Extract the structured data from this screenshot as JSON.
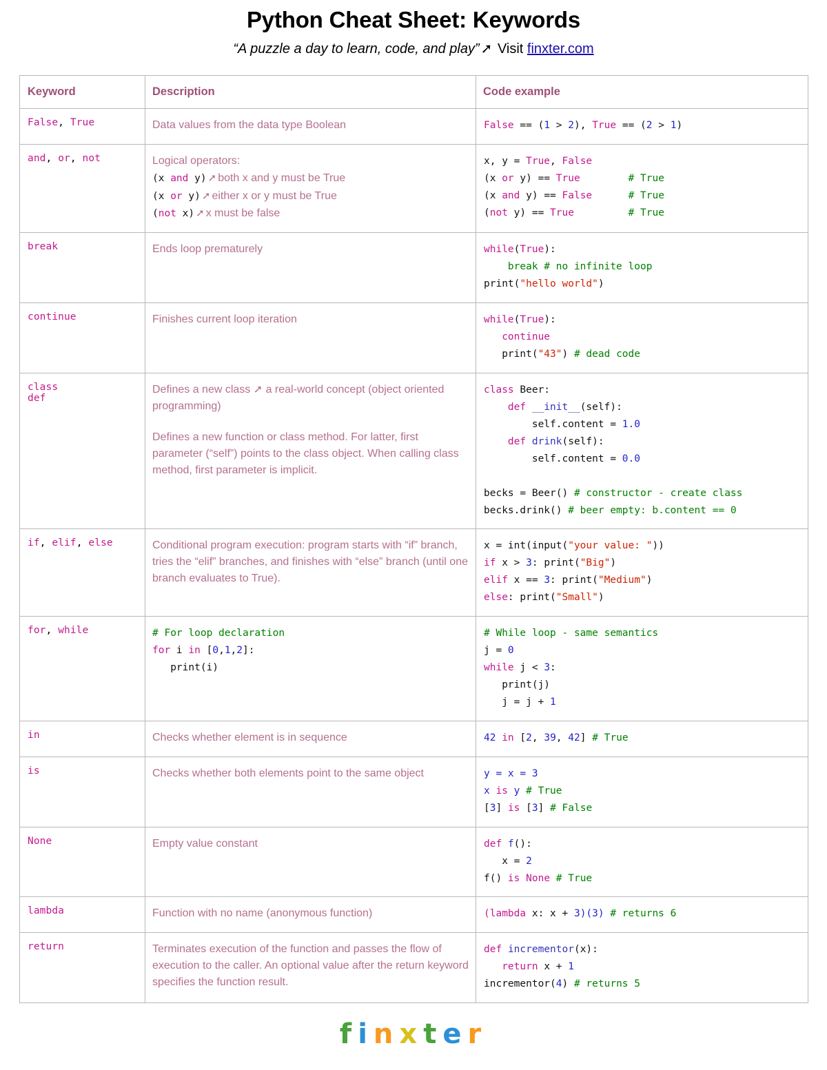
{
  "header": {
    "title": "Python Cheat Sheet: Keywords",
    "subtitle_quote": "“A puzzle a day to learn, code, and play”",
    "subtitle_arrow": "➚",
    "subtitle_visit": "Visit",
    "subtitle_link": "finxter.com"
  },
  "table": {
    "columns": [
      "Keyword",
      "Description",
      "Code example"
    ],
    "rows": [
      {
        "keyword": "False, True",
        "description": "Data values from the data type Boolean",
        "code": "False == (1 > 2), True == (2 > 1)"
      },
      {
        "keyword": "and, or, not",
        "description_title": "Logical operators:",
        "description_lines": [
          {
            "code": "(x and y)",
            "arrow": "➚",
            "text": "both x and y must be True"
          },
          {
            "code": "(x or y)",
            "arrow": "➚",
            "text": "either x or y must be True"
          },
          {
            "code": "(not x)",
            "arrow": "➚",
            "text": "x must be false"
          }
        ],
        "code": "x, y = True, False\n(x or y) == True        # True\n(x and y) == False      # True\n(not y) == True         # True"
      },
      {
        "keyword": "break",
        "description": "Ends loop prematurely",
        "code": "while(True):\n    break # no infinite loop\nprint(\"hello world\")"
      },
      {
        "keyword": "continue",
        "description": "Finishes current loop iteration",
        "code": "while(True):\n   continue\n   print(\"43\") # dead code"
      },
      {
        "keyword": "class",
        "keyword2": "def",
        "description": "Defines a new class ➚ a real-world concept (object oriented programming)",
        "description2": "Defines a new function or class method. For latter, first parameter (“self”) points to the class object. When calling class method, first parameter is implicit.",
        "code": "class Beer:\n    def __init__(self):\n        self.content = 1.0\n    def drink(self):\n        self.content = 0.0\n\nbecks = Beer() # constructor - create class\nbecks.drink() # beer empty: b.content == 0"
      },
      {
        "keyword": "if, elif, else",
        "description": "Conditional program execution: program starts with “if” branch, tries the “elif” branches, and finishes with “else” branch (until one branch evaluates to True).",
        "code": "x = int(input(\"your value: \"))\nif x > 3: print(\"Big\")\nelif x == 3: print(\"Medium\")\nelse: print(\"Small\")"
      },
      {
        "keyword": "for, while",
        "description_code": "# For loop declaration\nfor i in [0,1,2]:\n   print(i)",
        "code": "# While loop - same semantics\nj = 0\nwhile j < 3:\n   print(j)\n   j = j + 1"
      },
      {
        "keyword": "in",
        "description": "Checks whether element is in sequence",
        "code": "42 in [2, 39, 42] # True"
      },
      {
        "keyword": "is",
        "description": "Checks whether both elements point to the same object",
        "code": "y = x = 3\nx is y # True\n[3] is [3] # False"
      },
      {
        "keyword": "None",
        "description": "Empty value constant",
        "code": "def f():\n   x = 2\nf() is None # True"
      },
      {
        "keyword": "lambda",
        "description": "Function with no name (anonymous function)",
        "code": "(lambda x: x + 3)(3) # returns 6"
      },
      {
        "keyword": "return",
        "description": "Terminates execution of the function and passes the flow of execution to the caller. An optional value after the return keyword specifies the function result.",
        "code": "def incrementor(x):\n   return x + 1\nincrementor(4) # returns 5"
      }
    ]
  },
  "footer": {
    "logo_letters": [
      {
        "ch": "f",
        "color": "#4aa23c"
      },
      {
        "ch": "i",
        "color": "#2b8fd6"
      },
      {
        "ch": "n",
        "color": "#f79a1e"
      },
      {
        "ch": "x",
        "color": "#d6c01e"
      },
      {
        "ch": "t",
        "color": "#4aa23c"
      },
      {
        "ch": "e",
        "color": "#2b8fd6"
      },
      {
        "ch": "r",
        "color": "#f79a1e"
      }
    ]
  },
  "colors": {
    "keyword": "#c4188e",
    "header_text": "#a05078",
    "description_text": "#b5708f",
    "number": "#2222cc",
    "string": "#cc2200",
    "comment": "#008000",
    "function": "#3333bb",
    "border": "#b8b8b8",
    "link": "#1a0dab"
  }
}
